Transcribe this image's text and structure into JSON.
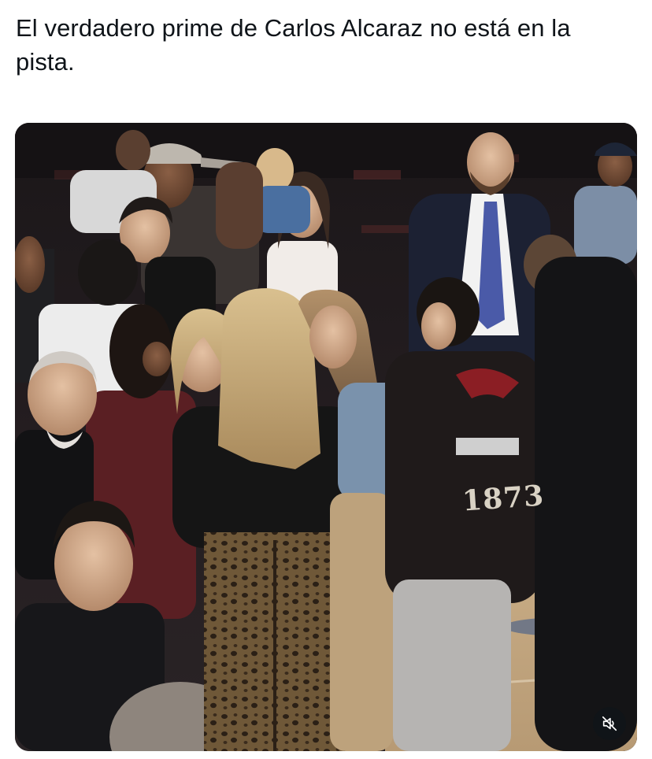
{
  "post": {
    "text": "El verdadero prime de Carlos Alcaraz no está en la pista."
  },
  "media": {
    "jacket_number": "1873",
    "mute_icon": "speaker-muted-icon"
  },
  "colors": {
    "text": "#0f1419",
    "background": "#ffffff",
    "overlay_button": "#0f1419"
  }
}
